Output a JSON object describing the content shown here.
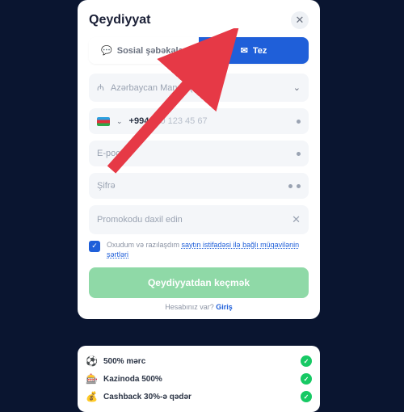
{
  "modal": {
    "title": "Qeydiyyat",
    "tabs": {
      "social": "Sosial şəbəkələr",
      "quick": "Tez"
    },
    "currency": {
      "label": "Azərbaycan Manatı (AZN)"
    },
    "phone": {
      "prefix": "+994",
      "placeholder": "40 123 45 67"
    },
    "email": {
      "placeholder": "E-poçt"
    },
    "password": {
      "placeholder": "Şifrə"
    },
    "promo": {
      "placeholder": "Promokodu daxil edin"
    },
    "agree": {
      "text": "Oxudum və razılaşdım ",
      "link": "saytın istifadəsi ilə bağlı müqavilənin şərtləri"
    },
    "submit": "Qeydiyyatdan keçmək",
    "login_prompt": "Hesabınız var? ",
    "login_link": "Giriş"
  },
  "bonuses": [
    {
      "icon": "⚽",
      "label": "500% mərc"
    },
    {
      "icon": "🎰",
      "label": "Kazinoda 500%"
    },
    {
      "icon": "💰",
      "label": "Cashback 30%-ə qədər"
    }
  ]
}
